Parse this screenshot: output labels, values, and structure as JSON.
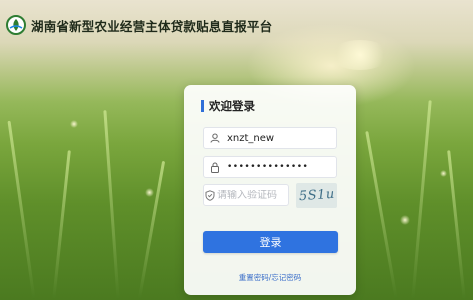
{
  "header": {
    "title": "湖南省新型农业经营主体贷款贴息直报平台"
  },
  "login": {
    "title": "欢迎登录",
    "username_value": "xnzt_new",
    "password_mask": "••••••••••••••",
    "captcha_placeholder": "请输入验证码",
    "captcha_text": "5S1u",
    "submit_label": "登录",
    "forgot_link": "重置密码/忘记密码"
  },
  "icons": {
    "logo": "platform-logo",
    "user": "user-icon",
    "lock": "lock-icon",
    "shield": "shield-check-icon"
  },
  "colors": {
    "accent": "#2f73e0",
    "title_bar": "#2f6fd8",
    "logo_green": "#2e7d32"
  }
}
